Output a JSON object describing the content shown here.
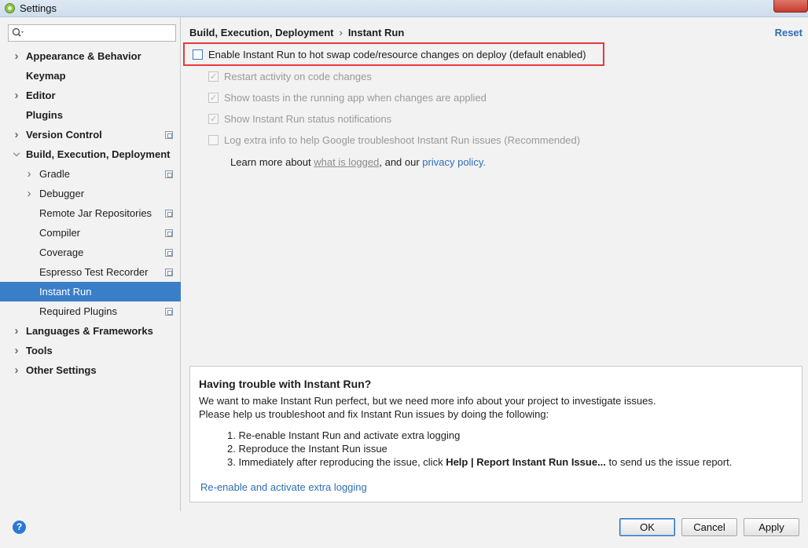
{
  "window": {
    "title": "Settings"
  },
  "search": {
    "value": "",
    "placeholder": ""
  },
  "tree": [
    {
      "label": "Appearance & Behavior",
      "bold": true,
      "level": 0,
      "arrow": "right",
      "project": false,
      "selected": false
    },
    {
      "label": "Keymap",
      "bold": true,
      "level": 0,
      "arrow": "",
      "project": false,
      "selected": false
    },
    {
      "label": "Editor",
      "bold": true,
      "level": 0,
      "arrow": "right",
      "project": false,
      "selected": false
    },
    {
      "label": "Plugins",
      "bold": true,
      "level": 0,
      "arrow": "",
      "project": false,
      "selected": false
    },
    {
      "label": "Version Control",
      "bold": true,
      "level": 0,
      "arrow": "right",
      "project": true,
      "selected": false
    },
    {
      "label": "Build, Execution, Deployment",
      "bold": true,
      "level": 0,
      "arrow": "down",
      "project": false,
      "selected": false
    },
    {
      "label": "Gradle",
      "bold": false,
      "level": 1,
      "arrow": "right",
      "project": true,
      "selected": false
    },
    {
      "label": "Debugger",
      "bold": false,
      "level": 1,
      "arrow": "right",
      "project": false,
      "selected": false
    },
    {
      "label": "Remote Jar Repositories",
      "bold": false,
      "level": 1,
      "arrow": "",
      "project": true,
      "selected": false
    },
    {
      "label": "Compiler",
      "bold": false,
      "level": 1,
      "arrow": "",
      "project": true,
      "selected": false
    },
    {
      "label": "Coverage",
      "bold": false,
      "level": 1,
      "arrow": "",
      "project": true,
      "selected": false
    },
    {
      "label": "Espresso Test Recorder",
      "bold": false,
      "level": 1,
      "arrow": "",
      "project": true,
      "selected": false
    },
    {
      "label": "Instant Run",
      "bold": false,
      "level": 1,
      "arrow": "",
      "project": false,
      "selected": true
    },
    {
      "label": "Required Plugins",
      "bold": false,
      "level": 1,
      "arrow": "",
      "project": true,
      "selected": false
    },
    {
      "label": "Languages & Frameworks",
      "bold": true,
      "level": 0,
      "arrow": "right",
      "project": false,
      "selected": false
    },
    {
      "label": "Tools",
      "bold": true,
      "level": 0,
      "arrow": "right",
      "project": false,
      "selected": false
    },
    {
      "label": "Other Settings",
      "bold": true,
      "level": 0,
      "arrow": "right",
      "project": false,
      "selected": false
    }
  ],
  "breadcrumb": {
    "parent": "Build, Execution, Deployment",
    "separator": "›",
    "current": "Instant Run"
  },
  "reset_label": "Reset",
  "options": {
    "enable": {
      "label": "Enable Instant Run to hot swap code/resource changes on deploy (default enabled)",
      "checked": false
    },
    "restart": {
      "label": "Restart activity on code changes",
      "checked": true,
      "enabled": false
    },
    "toasts": {
      "label": "Show toasts in the running app when changes are applied",
      "checked": true,
      "enabled": false
    },
    "status": {
      "label": "Show Instant Run status notifications",
      "checked": true,
      "enabled": false
    },
    "log": {
      "label": "Log extra info to help Google troubleshoot Instant Run issues (Recommended)",
      "checked": false,
      "enabled": false
    }
  },
  "learn_more": {
    "prefix": "Learn more about ",
    "what_link": "what is logged",
    "middle": ", and our ",
    "privacy_link": "privacy policy."
  },
  "trouble": {
    "heading": "Having trouble with Instant Run?",
    "line1": "We want to make Instant Run perfect, but we need more info about your project to investigate issues.",
    "line2": "Please help us troubleshoot and fix Instant Run issues by doing the following:",
    "step1": "1. Re-enable Instant Run and activate extra logging",
    "step2": "2. Reproduce the Instant Run issue",
    "step3_prefix": "3. Immediately after reproducing the issue, click ",
    "step3_bold": "Help | Report Instant Run Issue...",
    "step3_suffix": " to send us the issue report.",
    "link": "Re-enable and activate extra logging"
  },
  "buttons": {
    "help": "?",
    "ok": "OK",
    "cancel": "Cancel",
    "apply": "Apply"
  },
  "colors": {
    "selection": "#3b7ec8",
    "link": "#2f6db5",
    "highlight_border": "#e43b3b"
  }
}
